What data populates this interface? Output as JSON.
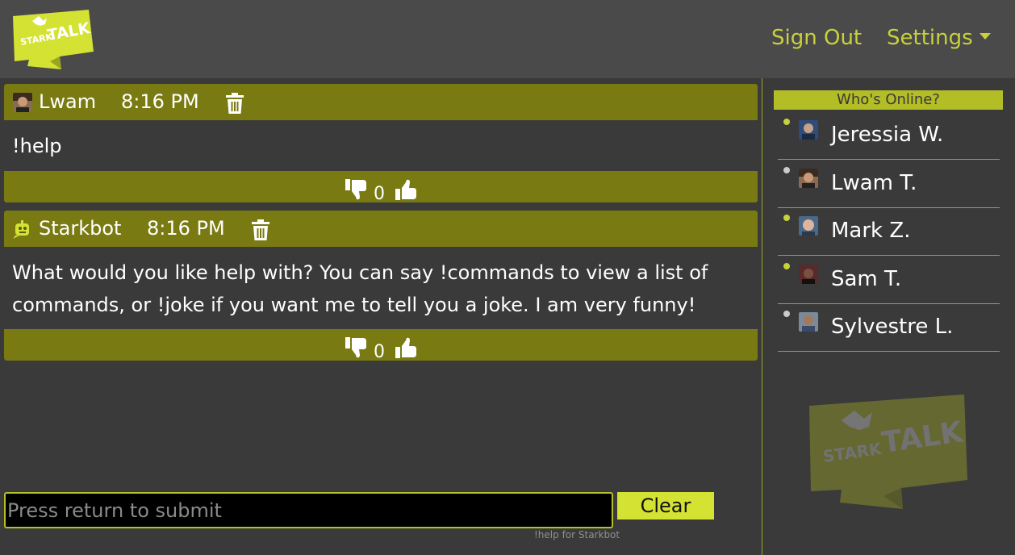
{
  "header": {
    "logo_top": "STARK",
    "logo_bottom": "TALK",
    "sign_out": "Sign Out",
    "settings": "Settings"
  },
  "colors": {
    "accent": "#c8d13a",
    "message_bar": "#7a7a12",
    "online_dot": "#c8d13a",
    "offline_dot": "#cccccc"
  },
  "messages": [
    {
      "author": "Lwam",
      "time": "8:16 PM",
      "text": "!help",
      "votes": "0",
      "avatar": "user-photo-icon"
    },
    {
      "author": "Starkbot",
      "time": "8:16 PM",
      "text": "What would you like help with? You can say !commands to view a list of commands, or !joke if you want me to tell you a joke. I am very funny!",
      "votes": "0",
      "avatar": "bot-icon"
    }
  ],
  "composer": {
    "placeholder": "Press return to submit",
    "value": "",
    "clear_label": "Clear",
    "hint": "!help for Starkbot"
  },
  "sidebar": {
    "title": "Who's Online?",
    "users": [
      {
        "name": "Jeressia W.",
        "online": true
      },
      {
        "name": "Lwam T.",
        "online": false
      },
      {
        "name": "Mark Z.",
        "online": true
      },
      {
        "name": "Sam T.",
        "online": true
      },
      {
        "name": "Sylvestre L.",
        "online": false
      }
    ],
    "watermark_top": "STARK",
    "watermark_bottom": "TALK"
  }
}
